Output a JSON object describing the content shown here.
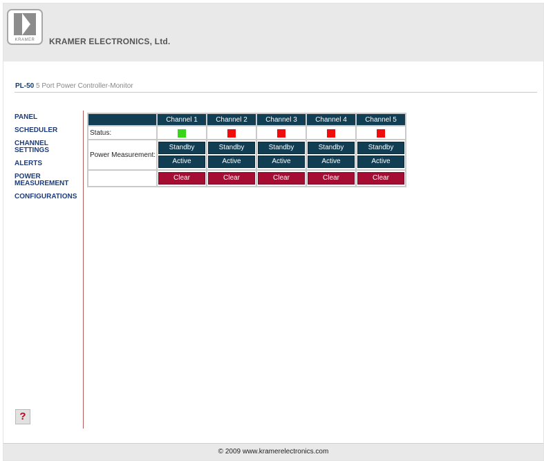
{
  "header": {
    "logo_text": "KRAMER",
    "company": "KRAMER ELECTRONICS, Ltd."
  },
  "product": {
    "model": "PL-50",
    "description": "5 Port Power Controller-Monitor"
  },
  "nav": {
    "items": [
      {
        "label": "PANEL"
      },
      {
        "label": "SCHEDULER"
      },
      {
        "label": "CHANNEL SETTINGS"
      },
      {
        "label": "ALERTS"
      },
      {
        "label": "POWER MEASUREMENT"
      },
      {
        "label": "CONFIGURATIONS"
      }
    ]
  },
  "help": {
    "label": "?"
  },
  "table": {
    "status_label": "Status:",
    "power_label": "Power Measurement:",
    "standby_label": "Standby",
    "active_label": "Active",
    "clear_label": "Clear",
    "channels": [
      {
        "name": "Channel 1",
        "status_color": "#37d61b"
      },
      {
        "name": "Channel 2",
        "status_color": "#ee0c0c"
      },
      {
        "name": "Channel 3",
        "status_color": "#ee0c0c"
      },
      {
        "name": "Channel 4",
        "status_color": "#ee0c0c"
      },
      {
        "name": "Channel 5",
        "status_color": "#ee0c0c"
      }
    ]
  },
  "footer": {
    "text": "© 2009 www.kramerelectronics.com"
  },
  "colors": {
    "header_bg": "#e9e9e9",
    "table_header": "#123e54",
    "clear_button": "#a50d33",
    "nav_link": "#1c3c7a",
    "status_on": "#37d61b",
    "status_off": "#ee0c0c"
  }
}
